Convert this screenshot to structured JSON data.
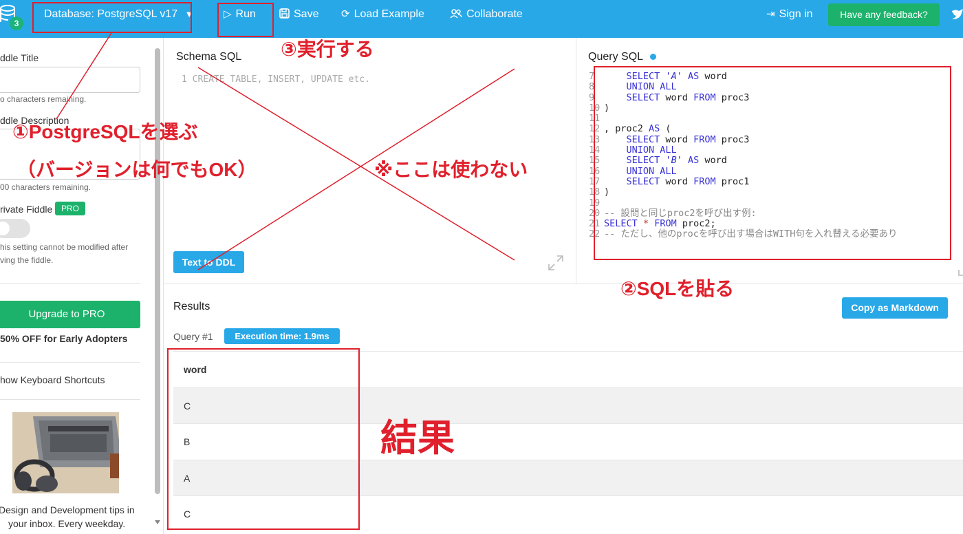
{
  "topbar": {
    "db_badge_count": "3",
    "database_label": "Database: PostgreSQL v17",
    "run_label": "Run",
    "save_label": "Save",
    "load_example_label": "Load Example",
    "collaborate_label": "Collaborate",
    "sign_in_label": "Sign in",
    "feedback_label": "Have any feedback?"
  },
  "sidebar": {
    "fiddle_title_label": "ddle Title",
    "title_chars_remaining": "o characters remaining.",
    "fiddle_description_label": "ddle Description",
    "desc_chars_remaining": "00 characters remaining.",
    "private_fiddle_label": "rivate Fiddle",
    "pro_badge": "PRO",
    "private_note_line1": "his setting cannot be modified after",
    "private_note_line2": "ving the fiddle.",
    "upgrade_label": "Upgrade to PRO",
    "discount_label": "50% OFF for Early Adopters",
    "shortcuts_label": "how Keyboard Shortcuts",
    "promo_line1": "Design and Development tips in",
    "promo_line2": "your inbox. Every weekday."
  },
  "schema": {
    "title": "Schema SQL",
    "placeholder": "1 CREATE TABLE, INSERT, UPDATE etc.",
    "text_to_ddl_label": "Text to DDL"
  },
  "query": {
    "title": "Query SQL",
    "lines": [
      {
        "n": "7",
        "html": "    <span class=\"kw\">SELECT</span> <span class=\"str\">'A'</span> <span class=\"kw\">AS</span> word"
      },
      {
        "n": "8",
        "html": "    <span class=\"kw\">UNION ALL</span>"
      },
      {
        "n": "9",
        "html": "    <span class=\"kw\">SELECT</span> word <span class=\"kw\">FROM</span> proc3"
      },
      {
        "n": "10",
        "html": ")"
      },
      {
        "n": "11",
        "html": ""
      },
      {
        "n": "12",
        "html": ", proc2 <span class=\"kw\">AS</span> ("
      },
      {
        "n": "13",
        "html": "    <span class=\"kw\">SELECT</span> word <span class=\"kw\">FROM</span> proc3"
      },
      {
        "n": "14",
        "html": "    <span class=\"kw\">UNION ALL</span>"
      },
      {
        "n": "15",
        "html": "    <span class=\"kw\">SELECT</span> <span class=\"str\">'B'</span> <span class=\"kw\">AS</span> word"
      },
      {
        "n": "16",
        "html": "    <span class=\"kw\">UNION ALL</span>"
      },
      {
        "n": "17",
        "html": "    <span class=\"kw\">SELECT</span> word <span class=\"kw\">FROM</span> proc1"
      },
      {
        "n": "18",
        "html": ")"
      },
      {
        "n": "19",
        "html": ""
      },
      {
        "n": "20",
        "html": "<span class=\"cm\">-- 設問と同じproc2を呼び出す例:</span>"
      },
      {
        "n": "21",
        "html": "<span class=\"kw\">SELECT</span> <span class=\"op\">*</span> <span class=\"kw\">FROM</span> proc2;"
      },
      {
        "n": "22",
        "html": "<span class=\"cm\">-- ただし、他のprocを呼び出す場合はWITH句を入れ替える必要あり</span>"
      }
    ]
  },
  "results": {
    "title": "Results",
    "copy_markdown_label": "Copy as Markdown",
    "query_label": "Query #1",
    "execution_time": "Execution time: 1.9ms",
    "columns": [
      "word"
    ],
    "rows": [
      "C",
      "B",
      "A",
      "C"
    ]
  },
  "annotations": {
    "step1_line1": "①PostgreSQLを選ぶ",
    "step1_line2": "（バージョンは何でもOK）",
    "step2": "②SQLを貼る",
    "step3": "③実行する",
    "unused_note": "※ここは使わない",
    "result_note": "結果"
  },
  "colors": {
    "brand_blue": "#29a8e8",
    "brand_green": "#1cb26b",
    "annotation_red": "#e0202c"
  }
}
